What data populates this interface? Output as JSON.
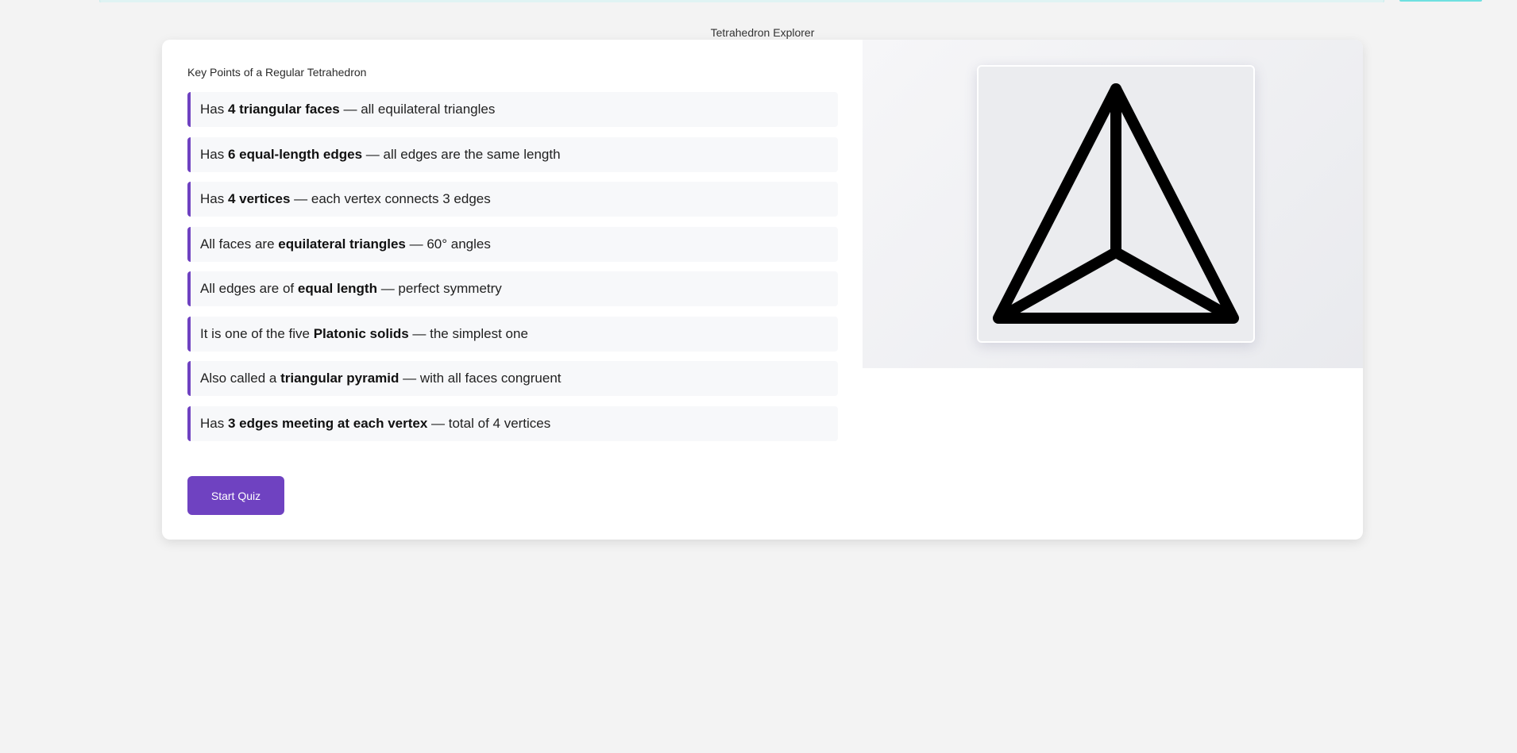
{
  "app": {
    "title": "Tetrahedron Explorer"
  },
  "section": {
    "title": "Key Points of a Regular Tetrahedron"
  },
  "points": [
    {
      "pre": "Has ",
      "bold": "4 triangular faces",
      "post": " — all equilateral triangles"
    },
    {
      "pre": "Has ",
      "bold": "6 equal-length edges",
      "post": " — all edges are the same length"
    },
    {
      "pre": "Has ",
      "bold": "4 vertices",
      "post": " — each vertex connects 3 edges"
    },
    {
      "pre": "All faces are ",
      "bold": "equilateral triangles",
      "post": " — 60° angles"
    },
    {
      "pre": "All edges are of ",
      "bold": "equal length",
      "post": " — perfect symmetry"
    },
    {
      "pre": "It is one of the five ",
      "bold": "Platonic solids",
      "post": " — the simplest one"
    },
    {
      "pre": "Also called a ",
      "bold": "triangular pyramid",
      "post": " — with all faces congruent"
    },
    {
      "pre": "Has ",
      "bold": "3 edges meeting at each vertex",
      "post": " — total of 4 vertices"
    }
  ],
  "actions": {
    "start_quiz_label": "Start Quiz"
  },
  "image": {
    "subject": "tetrahedron-drawing"
  },
  "colors": {
    "accent": "#6f42c1",
    "page_background": "#f3f3f3",
    "point_background": "#f7f8fa"
  }
}
